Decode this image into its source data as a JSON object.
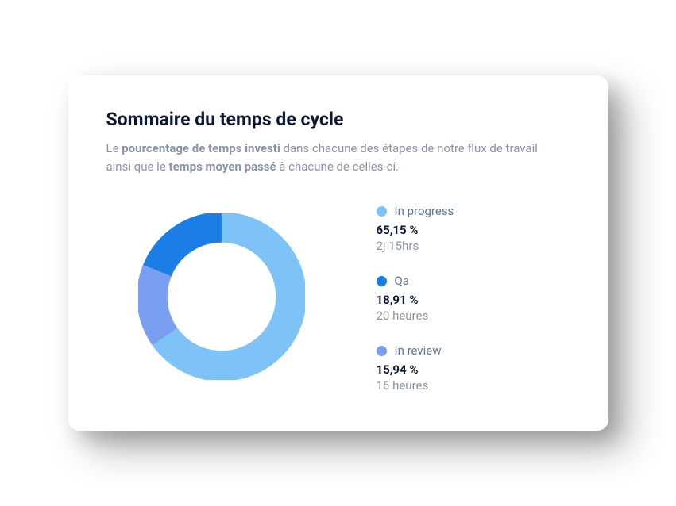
{
  "title": "Sommaire du temps de cycle",
  "subtitle": {
    "pre": "Le ",
    "bold1": "pourcentage de temps investi",
    "mid": " dans chacune des étapes de notre flux de travail ainsi que le ",
    "bold2": "temps moyen passé",
    "post": " à chacune de celles-ci."
  },
  "legend": [
    {
      "label": "In progress",
      "percent_display": "65,15 %",
      "time_display": "2j 15hrs",
      "color": "#7ec3f7"
    },
    {
      "label": "Qa",
      "percent_display": "18,91 %",
      "time_display": "20 heures",
      "color": "#1a7ee6"
    },
    {
      "label": "In review",
      "percent_display": "15,94 %",
      "time_display": "16 heures",
      "color": "#7a9ef0"
    }
  ],
  "chart_data": {
    "type": "pie",
    "title": "Sommaire du temps de cycle",
    "series": [
      {
        "name": "In progress",
        "value": 65.15,
        "color": "#7ec3f7",
        "time": "2j 15hrs"
      },
      {
        "name": "Qa",
        "value": 18.91,
        "color": "#1a7ee6",
        "time": "20 heures"
      },
      {
        "name": "In review",
        "value": 15.94,
        "color": "#7a9ef0",
        "time": "16 heures"
      }
    ]
  }
}
